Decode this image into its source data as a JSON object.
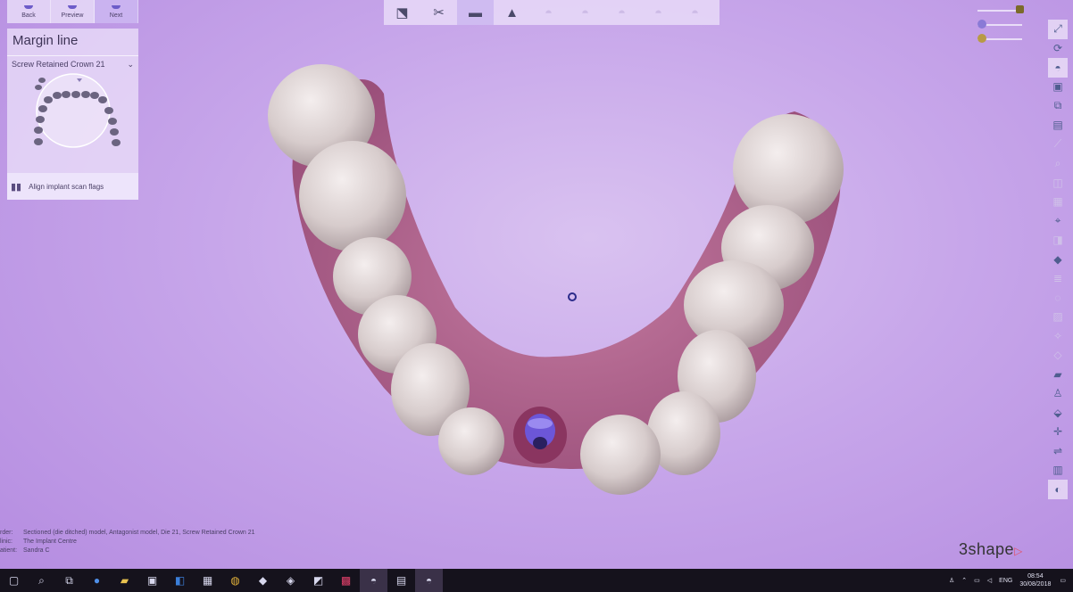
{
  "nav": {
    "back": "Back",
    "preview": "Preview",
    "next": "Next"
  },
  "panel": {
    "title": "Margin line",
    "dropdown_value": "Screw Retained Crown 21",
    "align_label": "Align implant scan flags"
  },
  "toolbar": {
    "tools": [
      "scan-icon",
      "cut-icon",
      "die-icon",
      "margin-icon",
      "tooth-icon",
      "tooth-icon",
      "tooth-icon",
      "tooth-icon",
      "tooth-icon"
    ],
    "active_index": 2
  },
  "order": {
    "order_label": "rder:",
    "order_value": "Sectioned (die ditched) model, Antagonist model, Die 21, Screw Retained Crown 21",
    "clinic_label": "linic:",
    "clinic_value": "The Implant Centre",
    "patient_label": "atient:",
    "patient_value": "Sandra C"
  },
  "brand": {
    "name": "3shape",
    "accent": "#e0536a"
  },
  "taskbar": {
    "language": "ENG",
    "time": "08:54",
    "date": "30/08/2018"
  },
  "colors": {
    "background": "#c7a6ea",
    "panel": "#ece2fa",
    "accent": "#6d5cc9",
    "taskbar": "#15121c"
  }
}
